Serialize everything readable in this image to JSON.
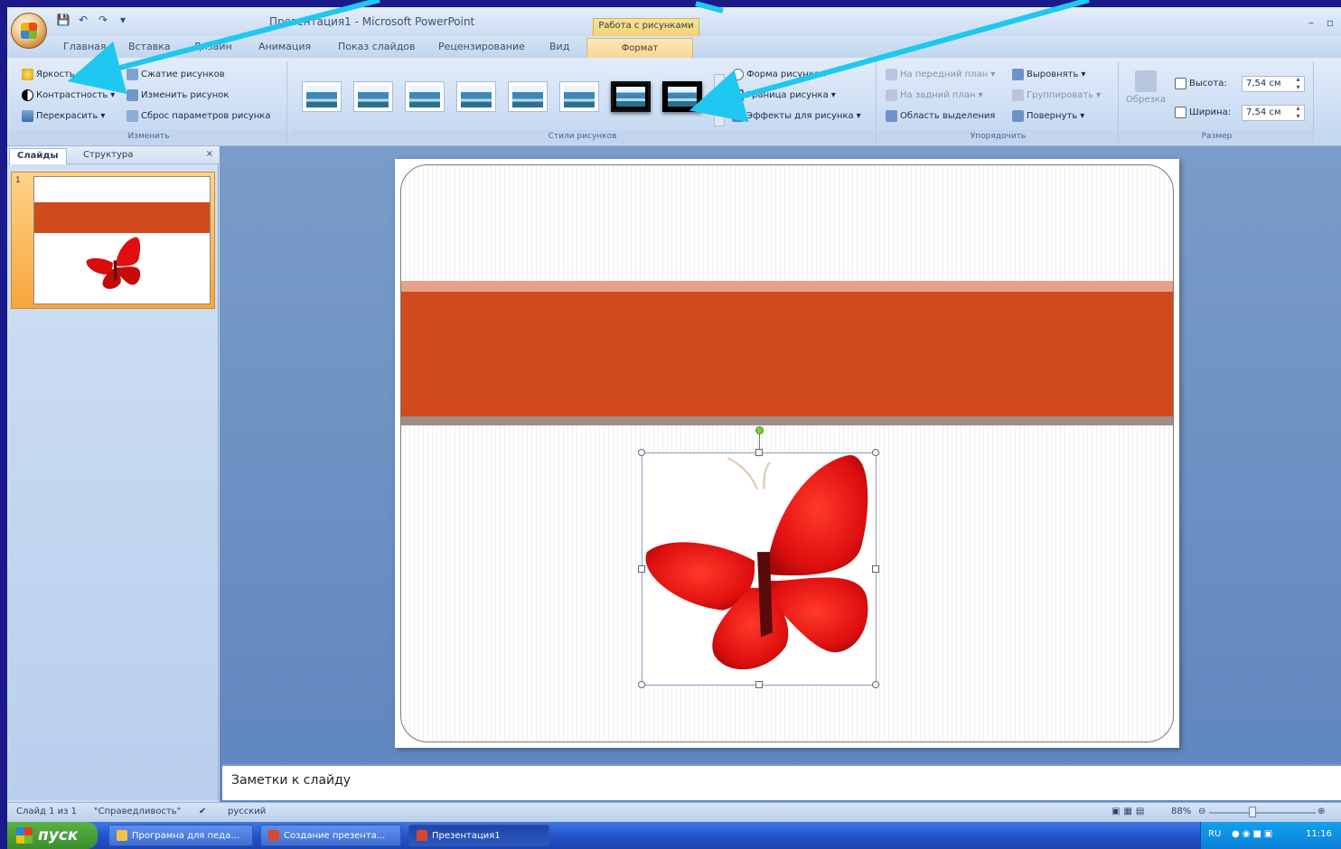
{
  "window": {
    "title": "Презентация1 - Microsoft PowerPoint",
    "context_tab_group": "Работа с рисунками",
    "controls": [
      "–",
      "▫"
    ]
  },
  "tabs": [
    "Главная",
    "Вставка",
    "Дизайн",
    "Анимация",
    "Показ слайдов",
    "Рецензирование",
    "Вид",
    "Формат"
  ],
  "ribbon": {
    "adjust": {
      "label": "Изменить",
      "brightness": "Яркость",
      "contrast": "Контрастность",
      "recolor": "Перекрасить",
      "compress": "Сжатие рисунков",
      "change": "Изменить рисунок",
      "reset": "Сброс параметров рисунка"
    },
    "styles": {
      "label": "Стили рисунков",
      "shape": "Форма рисунка",
      "border": "Граница рисунка",
      "effects": "Эффекты для рисунка"
    },
    "arrange": {
      "label": "Упорядочить",
      "front": "На передний план",
      "back": "На задний план",
      "selection": "Область выделения",
      "align": "Выровнять",
      "group": "Группировать",
      "rotate": "Повернуть"
    },
    "size": {
      "label": "Размер",
      "crop": "Обрезка",
      "height_label": "Высота:",
      "height_value": "7,54 см",
      "width_label": "Ширина:",
      "width_value": "7,54 см"
    }
  },
  "left_pane": {
    "tab_slides": "Слайды",
    "tab_outline": "Структура",
    "close": "×",
    "slide_number": "1"
  },
  "notes": {
    "placeholder": "Заметки к слайду"
  },
  "statusbar": {
    "slide_info": "Слайд 1 из 1",
    "theme": "\"Справедливость\"",
    "language": "русский",
    "zoom": "88%"
  },
  "taskbar": {
    "start": "пуск",
    "tasks": [
      "Програмна для педа...",
      "Создание презента...",
      "Презентация1"
    ],
    "lang": "RU",
    "time": "11:16"
  },
  "colors": {
    "band": "#d04a1c",
    "butterfly": "#e01010",
    "annotation_arrow": "#1ec8f0"
  }
}
